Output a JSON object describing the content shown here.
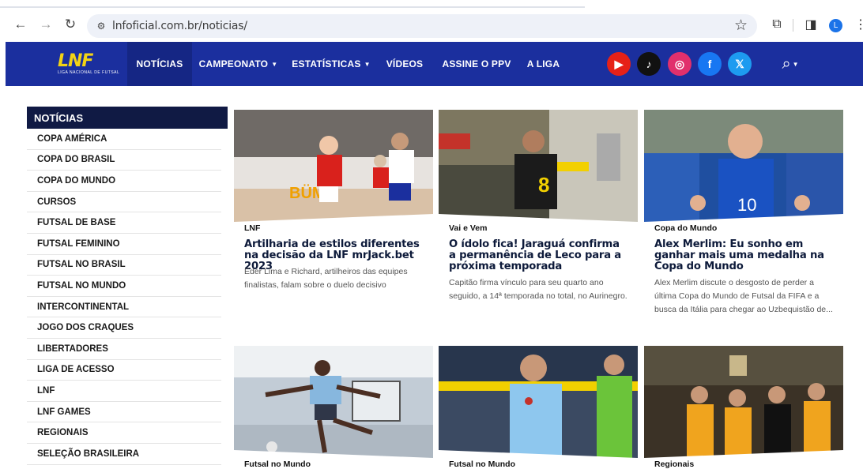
{
  "browser": {
    "url": "lnfoficial.com.br/noticias/",
    "profile_initial": "L"
  },
  "nav": {
    "logo_text": "LNF",
    "logo_subtitle": "LIGA NACIONAL DE FUTSAL",
    "items": [
      {
        "label": "NOTÍCIAS"
      },
      {
        "label": "CAMPEONATO"
      },
      {
        "label": "ESTATÍSTICAS"
      },
      {
        "label": "VÍDEOS"
      },
      {
        "label": "ASSINE O PPV"
      },
      {
        "label": "A LIGA"
      }
    ],
    "social": [
      {
        "name": "youtube-icon",
        "glyph": "▶",
        "color": "#e62117"
      },
      {
        "name": "tiktok-icon",
        "glyph": "♪",
        "color": "#111111"
      },
      {
        "name": "instagram-icon",
        "glyph": "◎",
        "color": "#e1306c"
      },
      {
        "name": "facebook-icon",
        "glyph": "f",
        "color": "#1877f2"
      },
      {
        "name": "x-icon",
        "glyph": "𝕏",
        "color": "#1d9bf0"
      }
    ],
    "colors": {
      "bar": "#1b2f9e",
      "active": "#152684",
      "logo": "#f3d315"
    }
  },
  "sidebar": {
    "title": "NOTÍCIAS",
    "items": [
      "COPA AMÉRICA",
      "COPA DO BRASIL",
      "COPA DO MUNDO",
      "CURSOS",
      "FUTSAL DE BASE",
      "FUTSAL FEMININO",
      "FUTSAL NO BRASIL",
      "FUTSAL NO MUNDO",
      "INTERCONTINENTAL",
      "JOGO DOS CRAQUES",
      "LIBERTADORES",
      "LIGA DE ACESSO",
      "LNF",
      "LNF GAMES",
      "REGIONAIS",
      "SELEÇÃO BRASILEIRA"
    ]
  },
  "articles": [
    {
      "category": "LNF",
      "headline": "Artilharia de estilos diferentes na decisão da LNF mrJack.bet 2023",
      "excerpt": "Éder Lima e Richard, artilheiros das equipes finalistas, falam sobre o duelo decisivo"
    },
    {
      "category": "Vai e Vem",
      "headline": "O ídolo fica! Jaraguá confirma a permanência de Leco para a próxima temporada",
      "excerpt": "Capitão firma vínculo para seu quarto ano seguido, a 14ª temporada no total, no Aurinegro."
    },
    {
      "category": "Copa do Mundo",
      "headline": "Alex Merlim: Eu sonho em ganhar mais uma medalha na Copa do Mundo",
      "excerpt": "Alex Merlim discute o desgosto de perder a última Copa do Mundo de Futsal da FIFA e a busca da Itália para chegar ao Uzbequistão de..."
    },
    {
      "category": "Futsal no Mundo"
    },
    {
      "category": "Futsal no Mundo"
    },
    {
      "category": "Regionais"
    }
  ]
}
